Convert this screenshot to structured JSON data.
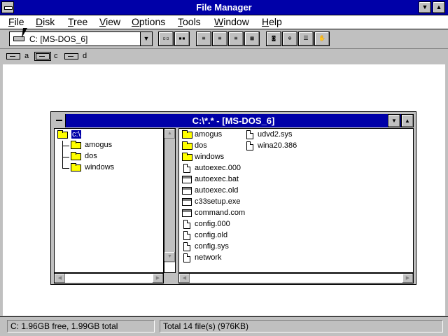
{
  "window": {
    "title": "File Manager"
  },
  "menu": [
    "File",
    "Disk",
    "Tree",
    "View",
    "Options",
    "Tools",
    "Window",
    "Help"
  ],
  "toolbar": {
    "drive_selector": "C: [MS-DOS_6]"
  },
  "drives": [
    {
      "letter": "a",
      "type": "floppy",
      "selected": false
    },
    {
      "letter": "c",
      "type": "hard-disk",
      "selected": true
    },
    {
      "letter": "d",
      "type": "cdrom",
      "selected": false
    }
  ],
  "child": {
    "title": "C:\\*.* - [MS-DOS_6]",
    "tree": {
      "root": "c:\\",
      "folders": [
        "amogus",
        "dos",
        "windows"
      ]
    },
    "files": {
      "col1": [
        {
          "name": "amogus",
          "type": "folder"
        },
        {
          "name": "dos",
          "type": "folder"
        },
        {
          "name": "windows",
          "type": "folder"
        },
        {
          "name": "autoexec.000",
          "type": "file"
        },
        {
          "name": "autoexec.bat",
          "type": "exe"
        },
        {
          "name": "autoexec.old",
          "type": "exe"
        },
        {
          "name": "c33setup.exe",
          "type": "exe"
        },
        {
          "name": "command.com",
          "type": "exe"
        },
        {
          "name": "config.000",
          "type": "file"
        },
        {
          "name": "config.old",
          "type": "file"
        },
        {
          "name": "config.sys",
          "type": "file"
        },
        {
          "name": "network",
          "type": "file"
        }
      ],
      "col2": [
        {
          "name": "udvd2.sys",
          "type": "file"
        },
        {
          "name": "wina20.386",
          "type": "file"
        }
      ]
    }
  },
  "status": {
    "left": "C: 1.96GB free,  1.99GB total",
    "right": "Total 14 file(s) (976KB)"
  },
  "colors": {
    "titlebar": "#0000a8",
    "face": "#c0c0c0",
    "folder": "#ffff00"
  }
}
